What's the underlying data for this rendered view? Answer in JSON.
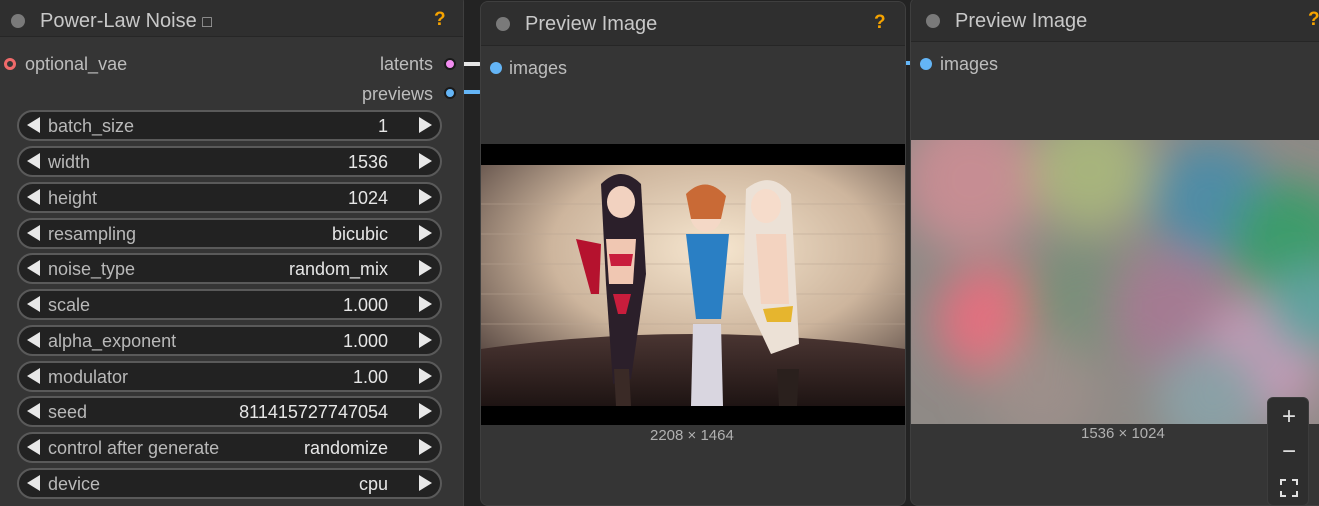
{
  "nodes": {
    "noise": {
      "title": "Power-Law Noise",
      "title_icon": "□",
      "help": "?",
      "inputs": [
        {
          "label": "optional_vae",
          "color": "#f06a6a"
        }
      ],
      "outputs": [
        {
          "label": "latents",
          "color": "#f28cf0"
        },
        {
          "label": "previews",
          "color": "#64b5f6"
        }
      ],
      "widgets": [
        {
          "name": "batch_size",
          "value": "1"
        },
        {
          "name": "width",
          "value": "1536"
        },
        {
          "name": "height",
          "value": "1024"
        },
        {
          "name": "resampling",
          "value": "bicubic"
        },
        {
          "name": "noise_type",
          "value": "random_mix"
        },
        {
          "name": "scale",
          "value": "1.000"
        },
        {
          "name": "alpha_exponent",
          "value": "1.000"
        },
        {
          "name": "modulator",
          "value": "1.00"
        },
        {
          "name": "seed",
          "value": "811415727747054"
        },
        {
          "name": "control after generate",
          "value": "randomize"
        },
        {
          "name": "device",
          "value": "cpu"
        }
      ]
    },
    "preview1": {
      "title": "Preview Image",
      "help": "?",
      "input_label": "images",
      "input_color": "#64b5f6",
      "image_size": "2208 × 1464",
      "image_icon": "anime-illustration-image"
    },
    "preview2": {
      "title": "Preview Image",
      "help": "?",
      "input_label": "images",
      "input_color": "#64b5f6",
      "image_size": "1536 × 1024",
      "image_icon": "colored-noise-image"
    }
  },
  "zoom_controls": {
    "zoom_in": "+",
    "zoom_out": "−",
    "fit_icon": "fit-view-icon"
  },
  "colors": {
    "help": "#f5a300",
    "latent_link": "#f28cf0",
    "image_link": "#64b5f6"
  }
}
